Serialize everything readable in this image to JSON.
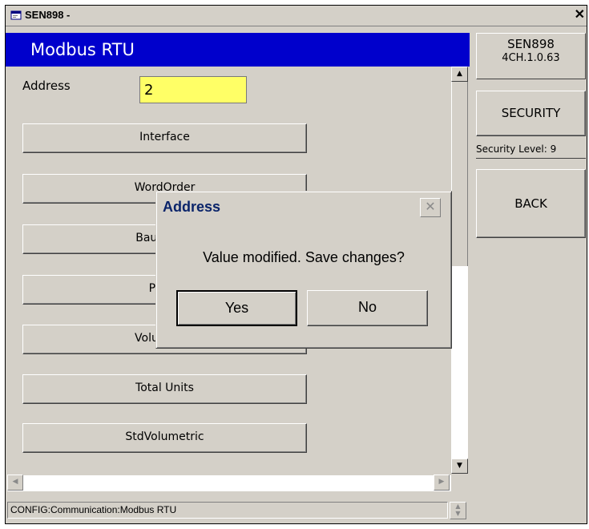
{
  "window": {
    "title": "SEN898 -",
    "close_glyph": "✕"
  },
  "header": {
    "title": "Modbus RTU"
  },
  "address_field": {
    "label": "Address",
    "value": "2"
  },
  "menu_buttons": [
    {
      "label": "Interface"
    },
    {
      "label": "WordOrder"
    },
    {
      "label": "Baud Rate"
    },
    {
      "label": "Parity"
    },
    {
      "label": "Volumetric"
    },
    {
      "label": "Total Units"
    },
    {
      "label": "StdVolumetric"
    }
  ],
  "side_panel": {
    "version_line1": "SEN898",
    "version_line2": "4CH.1.0.63",
    "security_button": "SECURITY",
    "security_level": "Security Level: 9",
    "back_button": "BACK"
  },
  "statusbar": {
    "text": "CONFIG:Communication:Modbus RTU"
  },
  "dialog": {
    "title": "Address",
    "message": "Value modified. Save changes?",
    "yes_label": "Yes",
    "no_label": "No",
    "close_glyph": "✕"
  },
  "icons": {
    "app": "app-window-icon",
    "scroll_up": "▲",
    "scroll_down": "▼",
    "scroll_left": "◀",
    "scroll_right": "▶",
    "spin_up": "▲",
    "spin_down": "▼"
  },
  "colors": {
    "header_bg": "#0000cc",
    "input_bg": "#ffff66",
    "dialog_title": "#0a246a",
    "face": "#d4d0c8"
  }
}
